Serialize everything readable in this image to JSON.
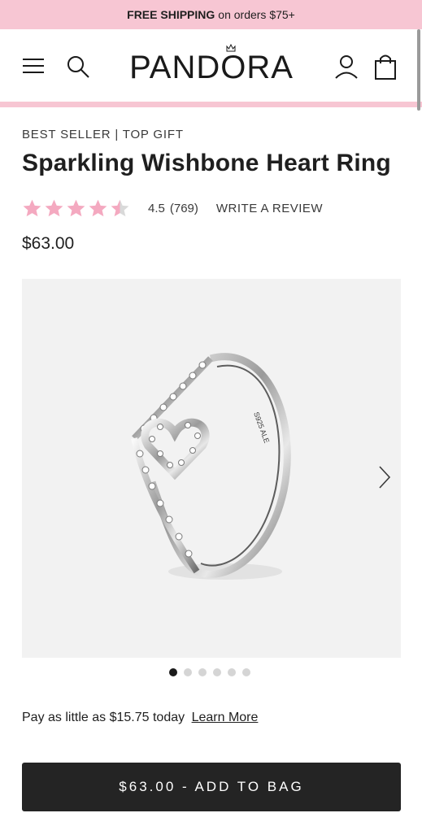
{
  "promo": {
    "bold": "FREE SHIPPING",
    "rest": "on orders $75+"
  },
  "header": {
    "logo": "PANDORA"
  },
  "product": {
    "eyebrow": "BEST SELLER | TOP GIFT",
    "title": "Sparkling Wishbone Heart Ring",
    "rating": {
      "value": "4.5",
      "stars_out_of_5": 4.5,
      "count": "(769)",
      "write_review": "WRITE A REVIEW"
    },
    "price": "$63.00",
    "engraving": "S925 ALE"
  },
  "gallery": {
    "slides": 6,
    "active_index": 0
  },
  "payment": {
    "text": "Pay as little as $15.75 today",
    "link": "Learn More"
  },
  "cta": {
    "label": "$63.00 - ADD TO BAG"
  },
  "colors": {
    "promo_pink": "#f7c6d3",
    "star_pink": "#f4a9c0",
    "button_dark": "#242424"
  },
  "icons": [
    "menu-icon",
    "search-icon",
    "account-icon",
    "bag-icon",
    "star-icon",
    "chevron-right-icon"
  ]
}
